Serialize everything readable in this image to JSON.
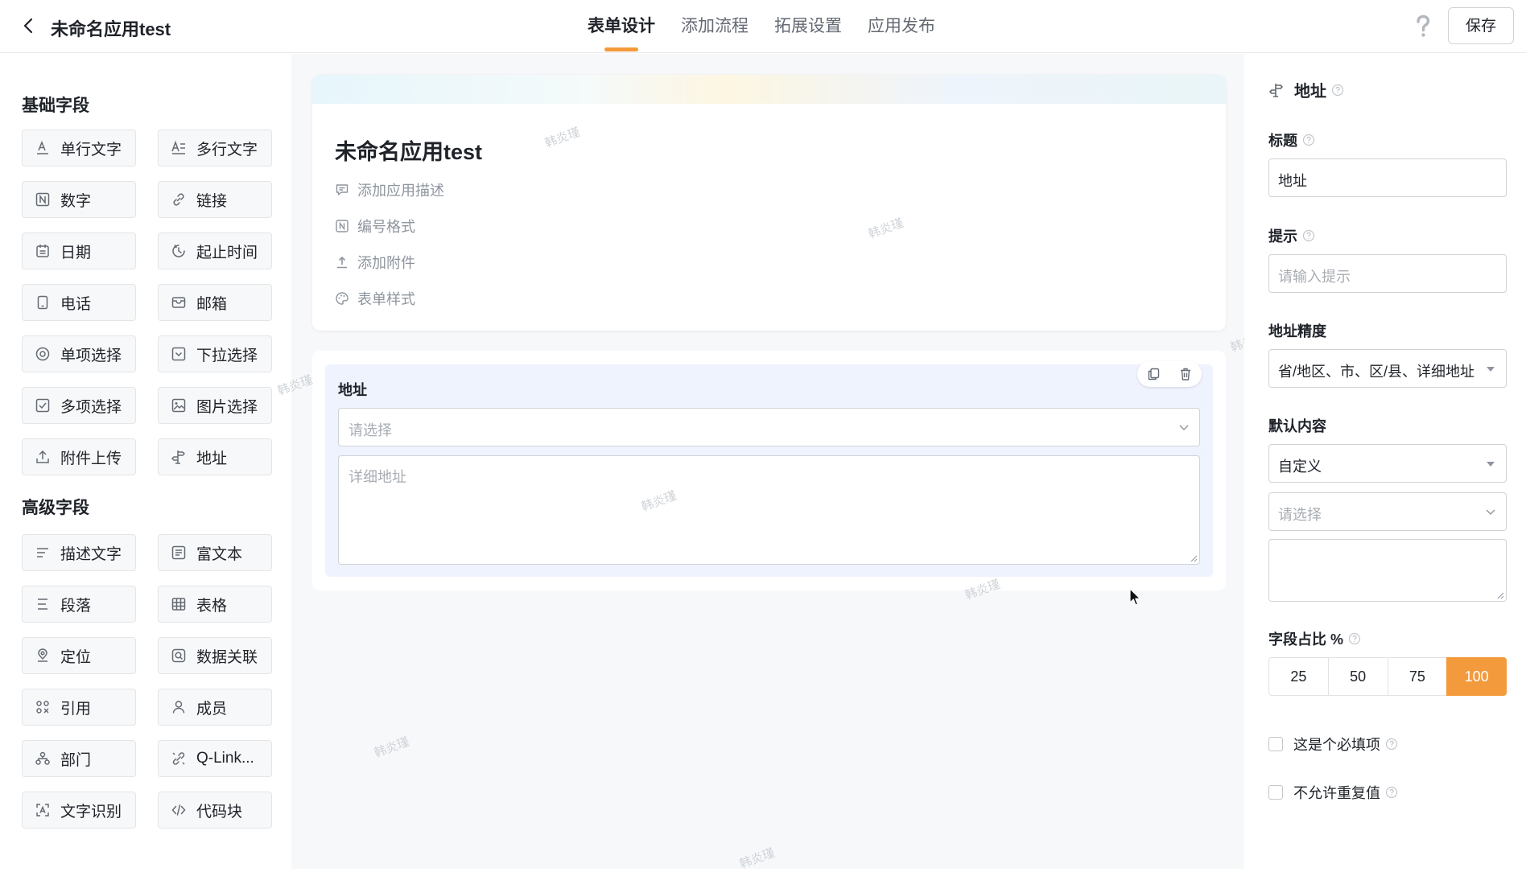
{
  "app": {
    "title": "未命名应用test"
  },
  "tabs": [
    {
      "label": "表单设计",
      "active": true
    },
    {
      "label": "添加流程",
      "active": false
    },
    {
      "label": "拓展设置",
      "active": false
    },
    {
      "label": "应用发布",
      "active": false
    }
  ],
  "header": {
    "save_label": "保存"
  },
  "left_panel": {
    "basic_title": "基础字段",
    "basic_fields": [
      {
        "label": "单行文字",
        "icon": "text-line-icon"
      },
      {
        "label": "多行文字",
        "icon": "text-multiline-icon"
      },
      {
        "label": "数字",
        "icon": "number-icon"
      },
      {
        "label": "链接",
        "icon": "link-icon"
      },
      {
        "label": "日期",
        "icon": "calendar-icon"
      },
      {
        "label": "起止时间",
        "icon": "time-range-icon"
      },
      {
        "label": "电话",
        "icon": "phone-icon"
      },
      {
        "label": "邮箱",
        "icon": "mail-icon"
      },
      {
        "label": "单项选择",
        "icon": "radio-icon"
      },
      {
        "label": "下拉选择",
        "icon": "dropdown-icon"
      },
      {
        "label": "多项选择",
        "icon": "checkbox-icon"
      },
      {
        "label": "图片选择",
        "icon": "image-icon"
      },
      {
        "label": "附件上传",
        "icon": "upload-icon"
      },
      {
        "label": "地址",
        "icon": "address-signpost-icon"
      }
    ],
    "advanced_title": "高级字段",
    "advanced_fields": [
      {
        "label": "描述文字",
        "icon": "description-icon"
      },
      {
        "label": "富文本",
        "icon": "rich-text-icon"
      },
      {
        "label": "段落",
        "icon": "paragraph-icon"
      },
      {
        "label": "表格",
        "icon": "table-icon"
      },
      {
        "label": "定位",
        "icon": "location-icon"
      },
      {
        "label": "数据关联",
        "icon": "data-link-icon"
      },
      {
        "label": "引用",
        "icon": "reference-icon"
      },
      {
        "label": "成员",
        "icon": "member-icon"
      },
      {
        "label": "部门",
        "icon": "department-icon"
      },
      {
        "label": "Q-Link...",
        "icon": "qlink-icon"
      },
      {
        "label": "文字识别",
        "icon": "ocr-icon"
      },
      {
        "label": "代码块",
        "icon": "code-icon"
      }
    ]
  },
  "form": {
    "title": "未命名应用test",
    "meta": [
      {
        "label": "添加应用描述",
        "icon": "comment-icon"
      },
      {
        "label": "编号格式",
        "icon": "number-format-icon"
      },
      {
        "label": "添加附件",
        "icon": "attachment-upload-icon"
      },
      {
        "label": "表单样式",
        "icon": "palette-icon"
      }
    ],
    "field": {
      "label": "地址",
      "select_placeholder": "请选择",
      "detail_placeholder": "详细地址"
    }
  },
  "watermark_text": "韩炎瑾",
  "right_panel": {
    "header": "地址",
    "title_label": "标题",
    "title_value": "地址",
    "hint_label": "提示",
    "hint_placeholder": "请输入提示",
    "precision_label": "地址精度",
    "precision_value": "省/地区、市、区/县、详细地址",
    "default_label": "默认内容",
    "default_mode": "自定义",
    "default_select_placeholder": "请选择",
    "ratio_label": "字段占比 %",
    "ratio_options": [
      "25",
      "50",
      "75",
      "100"
    ],
    "ratio_selected": "100",
    "required_label": "这是个必填项",
    "unique_label": "不允许重复值"
  },
  "colors": {
    "accent": "#f39a3c",
    "field_highlight": "#eff3fe",
    "canvas_bg": "#f7f8fa"
  }
}
